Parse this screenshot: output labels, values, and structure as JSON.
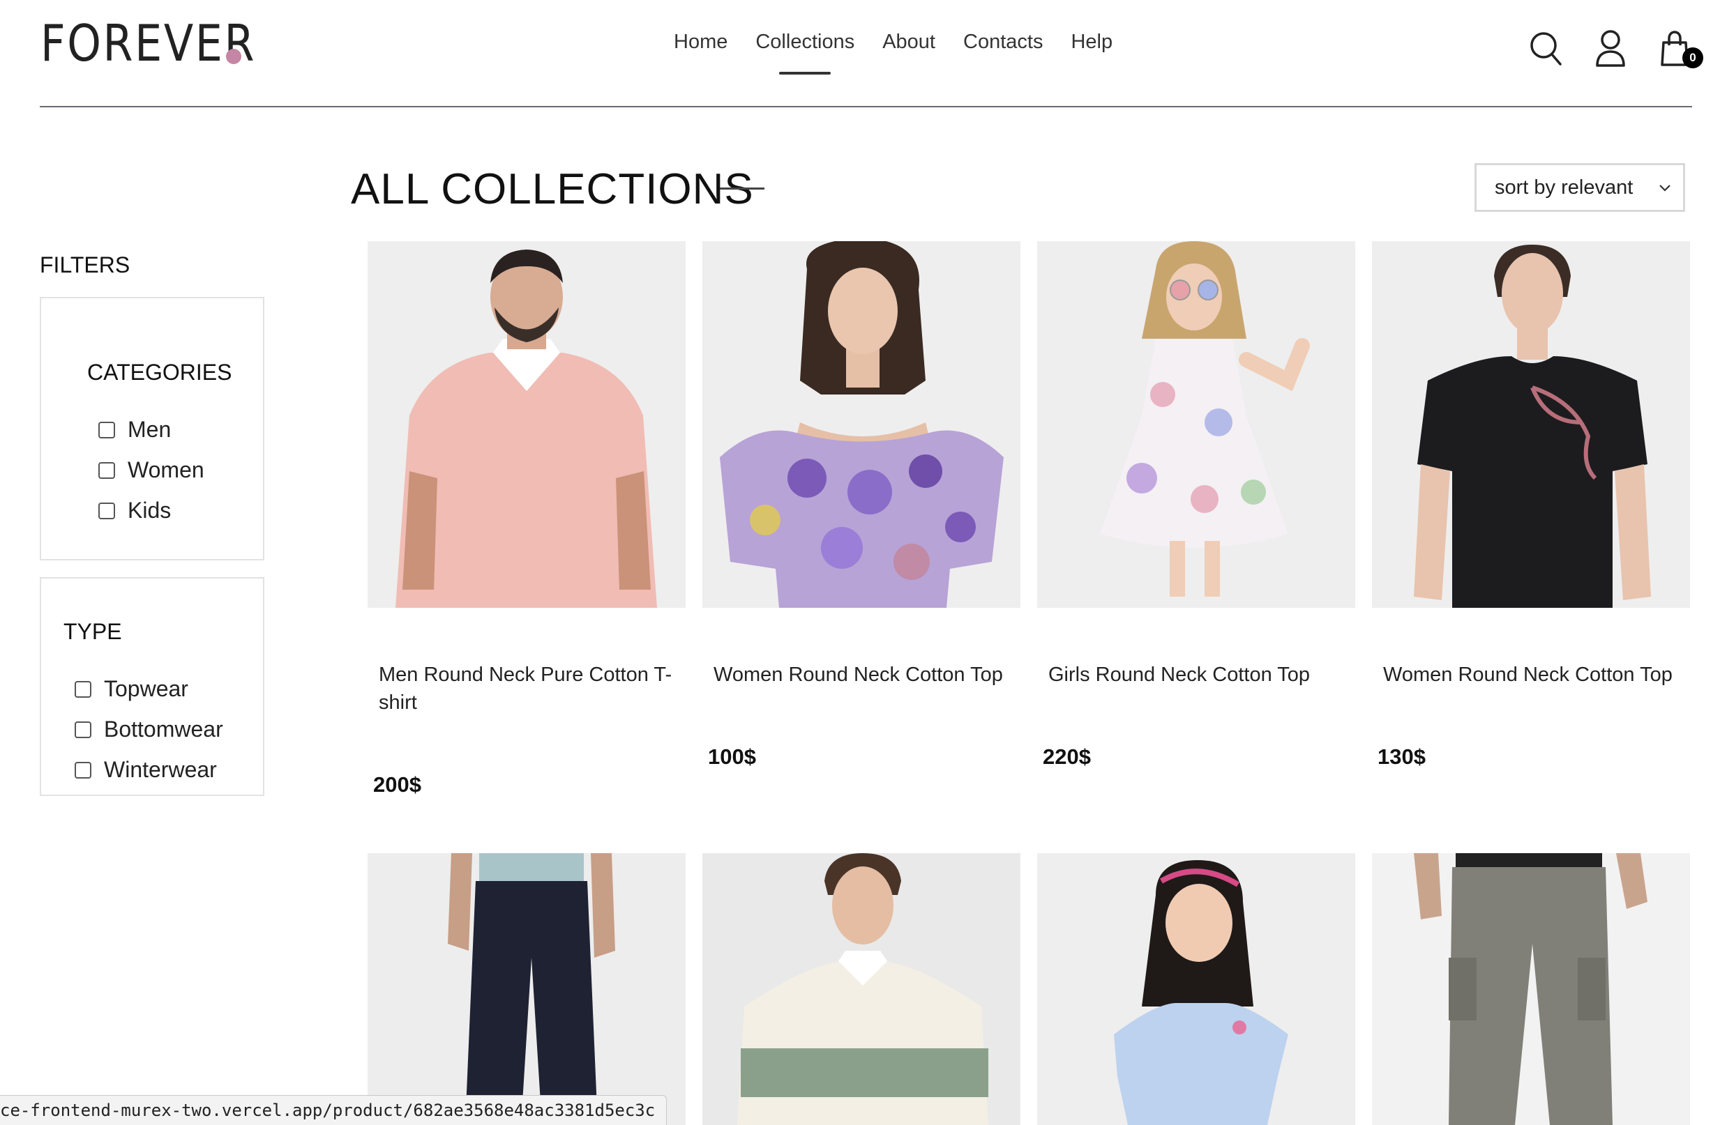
{
  "header": {
    "logo_text": "FOREVER",
    "brand_dot_color": "#c586a5",
    "nav": [
      {
        "label": "Home"
      },
      {
        "label": "Collections",
        "active": true
      },
      {
        "label": "About"
      },
      {
        "label": "Contacts"
      },
      {
        "label": "Help"
      }
    ],
    "icons": [
      "search-icon",
      "profile-icon",
      "cart-icon"
    ],
    "cart_count": "0"
  },
  "sidebar": {
    "title": "FILTERS",
    "categories": {
      "heading": "CATEGORIES",
      "options": [
        {
          "label": "Men",
          "checked": false
        },
        {
          "label": "Women",
          "checked": false
        },
        {
          "label": "Kids",
          "checked": false
        }
      ]
    },
    "type": {
      "heading": "TYPE",
      "options": [
        {
          "label": "Topwear",
          "checked": false
        },
        {
          "label": "Bottomwear",
          "checked": false
        },
        {
          "label": "Winterwear",
          "checked": false
        }
      ]
    }
  },
  "main": {
    "title": "ALL COLLECTIONS",
    "sort": {
      "selected": "sort by relevant"
    },
    "products": [
      {
        "name": "Men Round Neck Pure Cotton T-shirt",
        "price": "200$",
        "image": "man-pink-polo-photo"
      },
      {
        "name": "Women Round Neck Cotton Top",
        "price": "100$",
        "image": "woman-floral-top-photo"
      },
      {
        "name": "Girls Round Neck Cotton Top",
        "price": "220$",
        "image": "girl-floral-dress-photo"
      },
      {
        "name": "Women Round Neck Cotton Top",
        "price": "130$",
        "image": "woman-black-tee-photo"
      },
      {
        "image": "man-dark-jeans-photo"
      },
      {
        "image": "man-striped-rugby-photo"
      },
      {
        "image": "girl-blue-top-photo"
      },
      {
        "image": "man-cargo-pants-photo"
      }
    ]
  },
  "status_bar": {
    "url": "ce-frontend-murex-two.vercel.app/product/682ae3568e48ac3381d5ec3c"
  }
}
